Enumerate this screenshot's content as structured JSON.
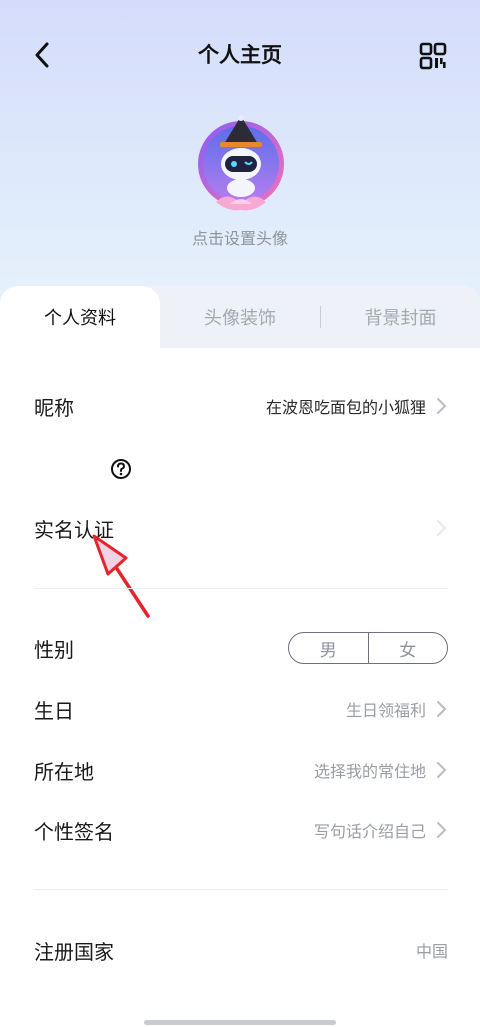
{
  "header": {
    "title": "个人主页",
    "back_icon": "chevron-left-icon",
    "qr_icon": "qr-code-icon"
  },
  "avatar": {
    "hint": "点击设置头像"
  },
  "tabs": [
    {
      "label": "个人资料",
      "active": true
    },
    {
      "label": "头像装饰",
      "active": false
    },
    {
      "label": "背景封面",
      "active": false
    }
  ],
  "profile": {
    "nickname": {
      "label": "昵称",
      "value": "在波恩吃面包的小狐狸"
    },
    "real_name": {
      "label": "实名认证",
      "value": ""
    },
    "gender": {
      "label": "性别",
      "options": [
        "男",
        "女"
      ]
    },
    "birthday": {
      "label": "生日",
      "value": "生日领福利"
    },
    "location": {
      "label": "所在地",
      "value": "选择我的常住地"
    },
    "signature": {
      "label": "个性签名",
      "value": "写句话介绍自己"
    },
    "country": {
      "label": "注册国家",
      "value": "中国"
    }
  },
  "colors": {
    "annotation_arrow": "#e3262b",
    "hero_gradient_top": "#d4dcfb",
    "hero_gradient_bottom": "#e8f2fc"
  }
}
